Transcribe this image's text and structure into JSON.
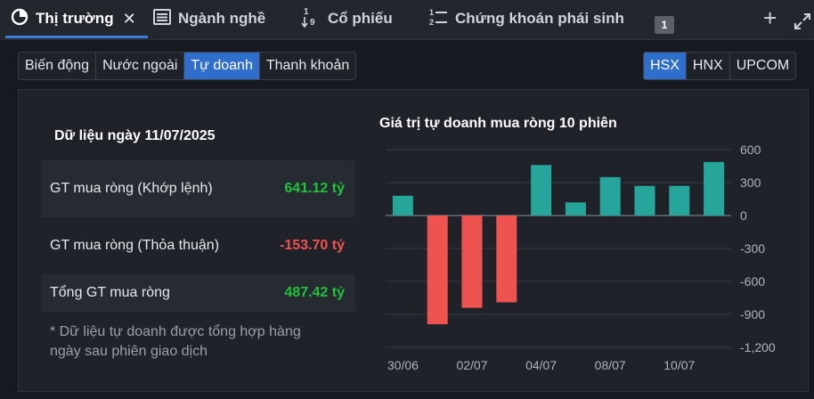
{
  "tabs": [
    {
      "label": "Thị trường",
      "icon": "pie-chart-icon",
      "active": true
    },
    {
      "label": "Ngành nghề",
      "icon": "list-icon"
    },
    {
      "label": "Cổ phiếu",
      "icon": "sort-numeric-icon"
    },
    {
      "label": "Chứng khoán phái sinh",
      "icon": "numbered-list-icon"
    }
  ],
  "tab_badge": "1",
  "view_buttons": [
    "Biến động",
    "Nước ngoài",
    "Tự doanh",
    "Thanh khoản"
  ],
  "view_active": "Tự doanh",
  "exchange_buttons": [
    "HSX",
    "HNX",
    "UPCOM"
  ],
  "exchange_active": "HSX",
  "summary": {
    "date_title": "Dữ liệu ngày 11/07/2025",
    "rows": [
      {
        "label": "GT mua ròng (Khớp lệnh)",
        "value": "641.12 tỷ",
        "trend": "up"
      },
      {
        "label": "GT mua ròng (Thỏa thuận)",
        "value": "-153.70 tỷ",
        "trend": "down"
      },
      {
        "label": "Tổng GT mua ròng",
        "value": "487.42 tỷ",
        "trend": "up"
      }
    ],
    "note": "* Dữ liệu tự doanh được tổng hợp hàng ngày sau phiên giao dịch"
  },
  "colors": {
    "positive": "#26a69a",
    "negative": "#ef5350",
    "accent": "#2f6fcb"
  },
  "chart_data": {
    "type": "bar",
    "title": "Giá trị tự doanh mua ròng 10 phiên",
    "categories": [
      "30/06",
      "01/07",
      "02/07",
      "03/07",
      "04/07",
      "07/07",
      "08/07",
      "09/07",
      "10/07",
      "11/07"
    ],
    "x_tick_labels": [
      "30/06",
      "02/07",
      "04/07",
      "08/07",
      "10/07"
    ],
    "values": [
      180,
      -990,
      -840,
      -790,
      460,
      120,
      350,
      270,
      270,
      487.42
    ],
    "ylim": [
      -1200,
      600
    ],
    "y_ticks": [
      600,
      300,
      0,
      -300,
      -600,
      -900,
      -1200
    ],
    "y_tick_labels": [
      "600",
      "300",
      "0",
      "-300",
      "-600",
      "-900",
      "-1,200"
    ],
    "grid": true
  }
}
